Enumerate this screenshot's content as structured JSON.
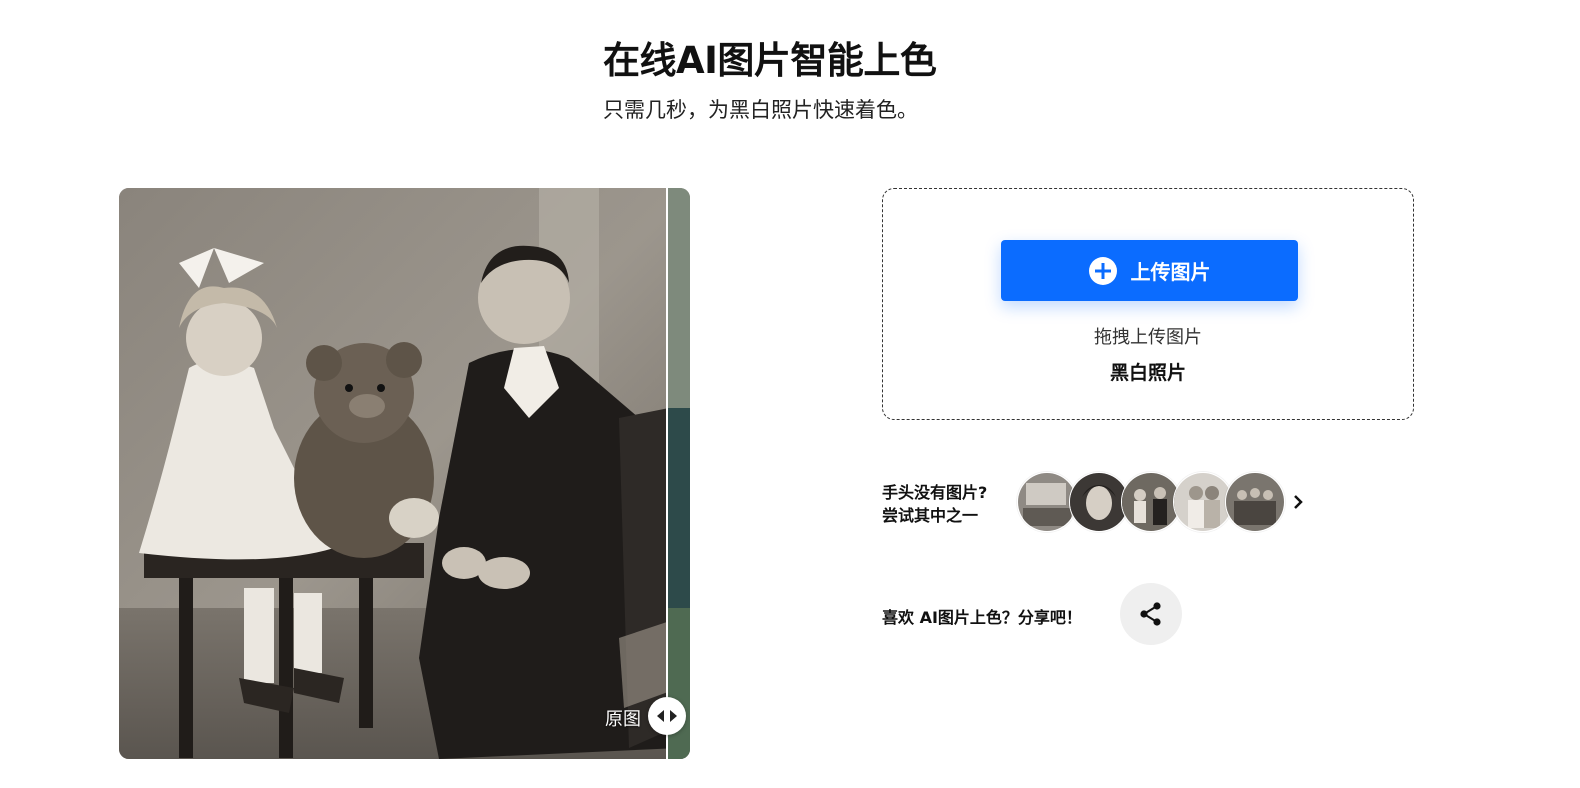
{
  "header": {
    "title": "在线AI图片智能上色",
    "subtitle": "只需几秒，为黑白照片快速着色。"
  },
  "compare": {
    "original_label": "原图",
    "image_description_icon": "vintage-photo"
  },
  "upload": {
    "button_label": "上传图片",
    "drag_text": "拖拽上传图片",
    "format_text": "黑白照片"
  },
  "samples": {
    "label_line1": "手头没有图片?",
    "label_line2": "尝试其中之一",
    "count": 5
  },
  "share": {
    "label": "喜欢 AI图片上色？分享吧！"
  },
  "colors": {
    "accent": "#0b6cff",
    "share_bg": "#efefef"
  }
}
